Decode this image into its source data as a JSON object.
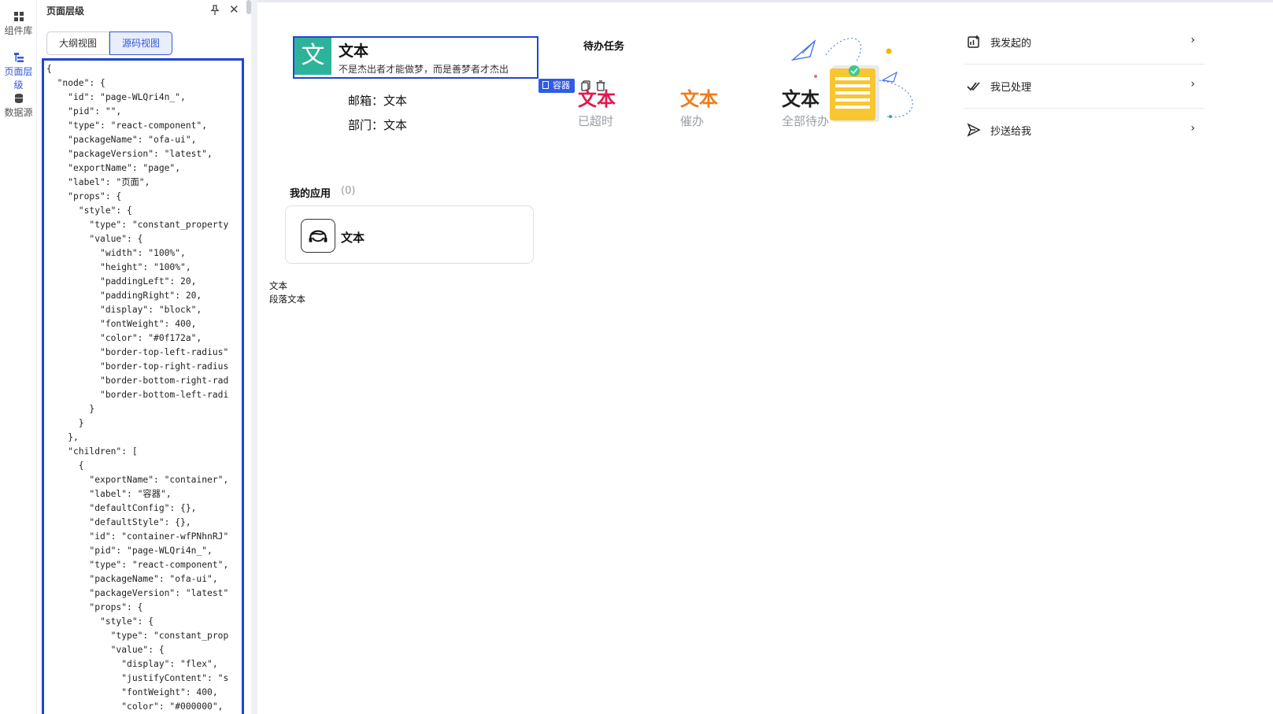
{
  "rail": {
    "items": [
      {
        "label": "组件库",
        "icon": "component-library-icon"
      },
      {
        "label": "页面层级",
        "icon": "page-hierarchy-icon"
      },
      {
        "label": "数据源",
        "icon": "database-icon"
      }
    ]
  },
  "panel": {
    "title": "页面层级",
    "tabs": {
      "outline": "大纲视图",
      "source": "源码视图"
    },
    "code_lines": [
      "{",
      "  \"node\": {",
      "    \"id\": \"page-WLQri4n_\",",
      "    \"pid\": \"\",",
      "    \"type\": \"react-component\",",
      "    \"packageName\": \"ofa-ui\",",
      "    \"packageVersion\": \"latest\",",
      "    \"exportName\": \"page\",",
      "    \"label\": \"页面\",",
      "    \"props\": {",
      "      \"style\": {",
      "        \"type\": \"constant_property",
      "        \"value\": {",
      "          \"width\": \"100%\",",
      "          \"height\": \"100%\",",
      "          \"paddingLeft\": 20,",
      "          \"paddingRight\": 20,",
      "          \"display\": \"block\",",
      "          \"fontWeight\": 400,",
      "          \"color\": \"#0f172a\",",
      "          \"border-top-left-radius\"",
      "          \"border-top-right-radius",
      "          \"border-bottom-right-rad",
      "          \"border-bottom-left-radi",
      "        }",
      "      }",
      "    },",
      "    \"children\": [",
      "      {",
      "        \"exportName\": \"container\",",
      "        \"label\": \"容器\",",
      "        \"defaultConfig\": {},",
      "        \"defaultStyle\": {},",
      "        \"id\": \"container-wfPNhnRJ\"",
      "        \"pid\": \"page-WLQri4n_\",",
      "        \"type\": \"react-component\",",
      "        \"packageName\": \"ofa-ui\",",
      "        \"packageVersion\": \"latest\"",
      "        \"props\": {",
      "          \"style\": {",
      "            \"type\": \"constant_prop",
      "            \"value\": {",
      "              \"display\": \"flex\",",
      "              \"justifyContent\": \"s",
      "              \"fontWeight\": 400,",
      "              \"color\": \"#000000\","
    ]
  },
  "canvas": {
    "profile": {
      "avatar_char": "文",
      "name": "文本",
      "motto": "不是杰出者才能做梦，而是善梦者才杰出"
    },
    "selection_toolbar": {
      "label": "容器"
    },
    "info": {
      "email_label": "邮箱：",
      "email_value": "文本",
      "dept_label": "部门：",
      "dept_value": "文本"
    },
    "todo": {
      "title": "待办任务",
      "stats": [
        {
          "value": "文本",
          "label": "已超时",
          "color": "#e0184d"
        },
        {
          "value": "文本",
          "label": "催办",
          "color": "#f07c1a"
        },
        {
          "value": "文本",
          "label": "全部待办",
          "color": "#1f1f1f"
        }
      ]
    },
    "quick_links": [
      {
        "label": "我发起的",
        "icon": "initiated-icon",
        "arrow": "›"
      },
      {
        "label": "我已处理",
        "icon": "processed-check-icon",
        "arrow": "›"
      },
      {
        "label": "抄送给我",
        "icon": "send-icon",
        "arrow": "›"
      }
    ],
    "apps": {
      "title": "我的应用",
      "count": "(0)",
      "card_name": "文本"
    },
    "text1": "文本",
    "text2": "段落文本"
  }
}
